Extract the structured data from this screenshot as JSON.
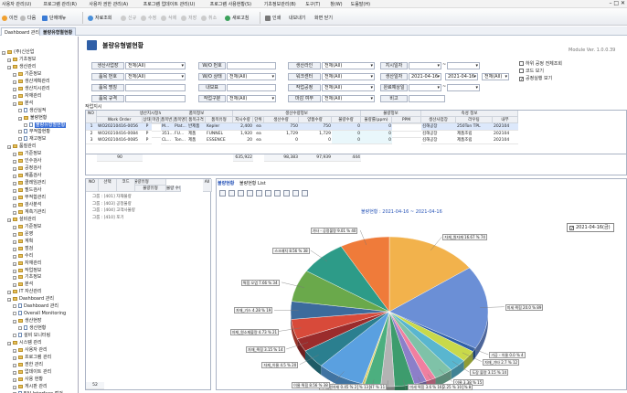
{
  "menubar": {
    "items": [
      "사용자 관리(U)",
      "프로그램 관리(R)",
      "사용자 권한 관리(A)",
      "프로그램 업데이트 관리(U)",
      "프로그램 사용현황(S)",
      "기초정보관리(B)",
      "도구(T)",
      "창(W)",
      "도움말(H)"
    ],
    "window_controls": "–  □  ✕"
  },
  "toolbar": {
    "prev": "이전",
    "next": "다음",
    "refresh": "단에메뉴",
    "search": "자료조회",
    "new": "신규",
    "edit": "수정",
    "del": "삭제",
    "save": "저장",
    "cancel": "취소",
    "reload": "새로고침",
    "print": "인쇄",
    "excel": "내보내기",
    "close": "화면 닫기"
  },
  "tabs": [
    "Dashboard 관리",
    "불량유형별현황"
  ],
  "page": {
    "title": "불량유형별현황",
    "module_version": "Module Ver. 1.0.0.39"
  },
  "sidebar": {
    "items": [
      {
        "label": "(주)신산업",
        "level": 0,
        "icon": "folder"
      },
      {
        "label": "기초정보",
        "level": 1,
        "icon": "folder"
      },
      {
        "label": "생산관리",
        "level": 1,
        "icon": "folder"
      },
      {
        "label": "기준정보",
        "level": 2,
        "icon": "folder"
      },
      {
        "label": "생산계획관리",
        "level": 2,
        "icon": "folder"
      },
      {
        "label": "생산지시관리",
        "level": 2,
        "icon": "folder"
      },
      {
        "label": "자재관리",
        "level": 2,
        "icon": "folder"
      },
      {
        "label": "분석",
        "level": 2,
        "icon": "folder"
      },
      {
        "label": "생산실적",
        "level": 3,
        "icon": "doc"
      },
      {
        "label": "불량현황",
        "level": 3,
        "icon": "folder"
      },
      {
        "label": "불량유형별현황",
        "level": 4,
        "icon": "doc",
        "selected": true
      },
      {
        "label": "부적합현황",
        "level": 3,
        "icon": "doc"
      },
      {
        "label": "재고정보",
        "level": 3,
        "icon": "doc"
      },
      {
        "label": "품질관리",
        "level": 1,
        "icon": "folder"
      },
      {
        "label": "기준정보",
        "level": 2,
        "icon": "folder"
      },
      {
        "label": "인수검사",
        "level": 2,
        "icon": "folder"
      },
      {
        "label": "공정검사",
        "level": 2,
        "icon": "folder"
      },
      {
        "label": "제품검사",
        "level": 2,
        "icon": "folder"
      },
      {
        "label": "클레임관리",
        "level": 2,
        "icon": "folder"
      },
      {
        "label": "필드검사",
        "level": 2,
        "icon": "folder"
      },
      {
        "label": "부적합관리",
        "level": 2,
        "icon": "folder"
      },
      {
        "label": "검사분석",
        "level": 2,
        "icon": "folder"
      },
      {
        "label": "계측기관리",
        "level": 2,
        "icon": "folder"
      },
      {
        "label": "설비관리",
        "level": 1,
        "icon": "folder"
      },
      {
        "label": "기준정보",
        "level": 2,
        "icon": "folder"
      },
      {
        "label": "운영",
        "level": 2,
        "icon": "folder"
      },
      {
        "label": "계획",
        "level": 2,
        "icon": "folder"
      },
      {
        "label": "점검",
        "level": 2,
        "icon": "folder"
      },
      {
        "label": "수리",
        "level": 2,
        "icon": "folder"
      },
      {
        "label": "자재관리",
        "level": 2,
        "icon": "folder"
      },
      {
        "label": "작업정보",
        "level": 2,
        "icon": "folder"
      },
      {
        "label": "기초정보",
        "level": 2,
        "icon": "folder"
      },
      {
        "label": "분석",
        "level": 2,
        "icon": "folder"
      },
      {
        "label": "IT 자산관리",
        "level": 1,
        "icon": "folder"
      },
      {
        "label": "Dashboard 관리",
        "level": 1,
        "icon": "folder"
      },
      {
        "label": "Dashboard 관리",
        "level": 2,
        "icon": "doc"
      },
      {
        "label": "Overall Monitoring",
        "level": 2,
        "icon": "doc"
      },
      {
        "label": "생산현장",
        "level": 2,
        "icon": "folder"
      },
      {
        "label": "생산현황",
        "level": 3,
        "icon": "doc"
      },
      {
        "label": "설비 모니터링",
        "level": 2,
        "icon": "doc"
      },
      {
        "label": "시스템 관리",
        "level": 1,
        "icon": "folder"
      },
      {
        "label": "사용자 관리",
        "level": 2,
        "icon": "folder"
      },
      {
        "label": "프로그램 관리",
        "level": 2,
        "icon": "folder"
      },
      {
        "label": "권한 관리",
        "level": 2,
        "icon": "folder"
      },
      {
        "label": "업데이트 관리",
        "level": 2,
        "icon": "folder"
      },
      {
        "label": "사용 현황",
        "level": 2,
        "icon": "folder"
      },
      {
        "label": "게시판 관리",
        "level": 2,
        "icon": "folder"
      },
      {
        "label": "EAI Interface 점검",
        "level": 2,
        "icon": "doc"
      }
    ]
  },
  "filters": [
    {
      "label": "생산사업장",
      "value": "전체(All)"
    },
    {
      "label": "W/O 번호",
      "value": ""
    },
    {
      "label": "생산라인",
      "value": "전체(All)"
    },
    {
      "label": "지시일자",
      "value": "",
      "extra": "~"
    },
    {
      "label": "품목 번호",
      "value": "전체(All)"
    },
    {
      "label": "W/O 상태",
      "value": "전체(All)"
    },
    {
      "label": "워크센터",
      "value": "전체(All)"
    },
    {
      "label": "생산일자",
      "value": "2021-04-16",
      "to": "2021-04-16",
      "preset": "전체(All)"
    },
    {
      "label": "품목 명칭",
      "value": ""
    },
    {
      "label": "내보표",
      "value": ""
    },
    {
      "label": "작업공정",
      "value": "전체(All)"
    },
    {
      "label": "완료예상일",
      "value": "",
      "extra": "~"
    },
    {
      "label": "품목 규격",
      "value": ""
    },
    {
      "label": "작업구분",
      "value": "전체(All)"
    },
    {
      "label": "마감 여부",
      "value": "전체(All)"
    },
    {
      "label": "비고",
      "value": ""
    }
  ],
  "options": [
    {
      "label": "하위 공정 전체조회",
      "checked": false
    },
    {
      "label": "코드 보기",
      "checked": false
    },
    {
      "label": "공정실행 보기",
      "checked": true
    }
  ],
  "grid": {
    "label": "작업지시",
    "group_headers": [
      "생산지시정보",
      "품목정보",
      "생산수량정보",
      "불량정보",
      "속성 정보"
    ],
    "columns": [
      "NO",
      "Work Order",
      "상태",
      "마감",
      "품목번호",
      "품목명칭",
      "품목규격",
      "품목유형",
      "지시수량",
      "단위",
      "생산수량",
      "양품수량",
      "불량수량",
      "불량률(ppm)",
      "PPM",
      "생산사업장",
      "라우팅",
      "내부"
    ],
    "rows": [
      [
        "1",
        "WO20210416-0056",
        "P",
        "",
        "M...",
        "Plat...",
        "반제품",
        "Kepler",
        "2,400",
        "ea",
        "750",
        "750",
        "0",
        "0",
        "",
        "김해공장",
        "250Ton TPL",
        "202104"
      ],
      [
        "2",
        "WO20210416-0084",
        "P",
        "",
        "351...",
        "FU...",
        "제품",
        "FUNNEL",
        "1,920",
        "ea",
        "1,729",
        "1,729",
        "0",
        "0",
        "",
        "김해공장",
        "제품조립",
        "202104"
      ],
      [
        "3",
        "WO20210416-0085",
        "P",
        "",
        "CL...",
        "Ton...",
        "제품",
        "ESSENCE",
        "20",
        "ea",
        "0",
        "0",
        "0",
        "0",
        "",
        "김해공장",
        "제품조립",
        "202104"
      ]
    ],
    "footer": {
      "count": "90",
      "order_qty": "635,922",
      "prod_qty": "98,383",
      "good_qty": "97,939",
      "defect_qty": "444"
    }
  },
  "defect_list": {
    "group_header": "불량유형",
    "columns": [
      "NO",
      "선택",
      "코드",
      "불량유형",
      "불량 수량",
      "All"
    ],
    "groups": [
      "그룹 : [401] 자재불량",
      "그룹 : [403] 공정불량",
      "그룹 : [404] 고객사불량",
      "그룹 : [410] 포기"
    ],
    "footer": "52"
  },
  "chart_tabs": [
    "불량현황",
    "불량현황 List"
  ],
  "chart_data": {
    "type": "pie",
    "title": "불량현황 : 2021-04-16 ~ 2021-04-16",
    "legend": [
      "2021-04-16(금)"
    ],
    "slices": [
      {
        "label": "자재_원자재 16.67 % 74",
        "value": 16.67,
        "color": "#f2b24c"
      },
      {
        "label": "미세 찍힘 20.0 % 89",
        "value": 20.0,
        "color": "#6b8fd6"
      },
      {
        "label": "가공 - 이물 0.0 % 4",
        "value": 0.9,
        "color": "#2e5fa8"
      },
      {
        "label": "자재_기타 2.7 % 12",
        "value": 2.7,
        "color": "#c9d94a"
      },
      {
        "label": "도장 불량 3.15 % 14",
        "value": 3.15,
        "color": "#59b6cf"
      },
      {
        "label": "이물 3.38 % 15",
        "value": 3.38,
        "color": "#7fc2a8"
      },
      {
        "label": "자재_기스 1.8 % 8",
        "value": 1.8,
        "color": "#f07fa0"
      },
      {
        "label": "스크래치 2.25 % 10",
        "value": 2.25,
        "color": "#8c7fc9"
      },
      {
        "label": "미세 찍힘 3.6 % 16",
        "value": 3.6,
        "color": "#3d9c6d"
      },
      {
        "label": "자재_그을음 2.47 % 11",
        "value": 2.47,
        "color": "#b3b3b3"
      },
      {
        "label": "공정_가공불량 2.92 % 13",
        "value": 2.92,
        "color": "#4caf7f"
      },
      {
        "label": "자재_원자재 0.45 % 2",
        "value": 0.45,
        "color": "#e3d26a"
      },
      {
        "label": "이물 찍힘 8.56 % 38",
        "value": 8.56,
        "color": "#5aa0e0"
      },
      {
        "label": "자재_이물 4.5 % 20",
        "value": 4.5,
        "color": "#2b7f8f"
      },
      {
        "label": "자재_찍힘 3.15 % 14",
        "value": 3.15,
        "color": "#9b2c2c"
      },
      {
        "label": "자재_원소재불량 4.73 % 21",
        "value": 4.73,
        "color": "#d84a3a"
      },
      {
        "label": "자재_기스 4.28 % 19",
        "value": 4.28,
        "color": "#3c6b9c"
      },
      {
        "label": "찍힘 오염 7.66 % 34",
        "value": 7.66,
        "color": "#6aa94b"
      },
      {
        "label": "스크래치 8.56 % 38",
        "value": 8.56,
        "color": "#2d9b88"
      },
      {
        "label": "기타 - 공정불량 9.01 % 40",
        "value": 9.01,
        "color": "#ef7b3a"
      }
    ]
  }
}
